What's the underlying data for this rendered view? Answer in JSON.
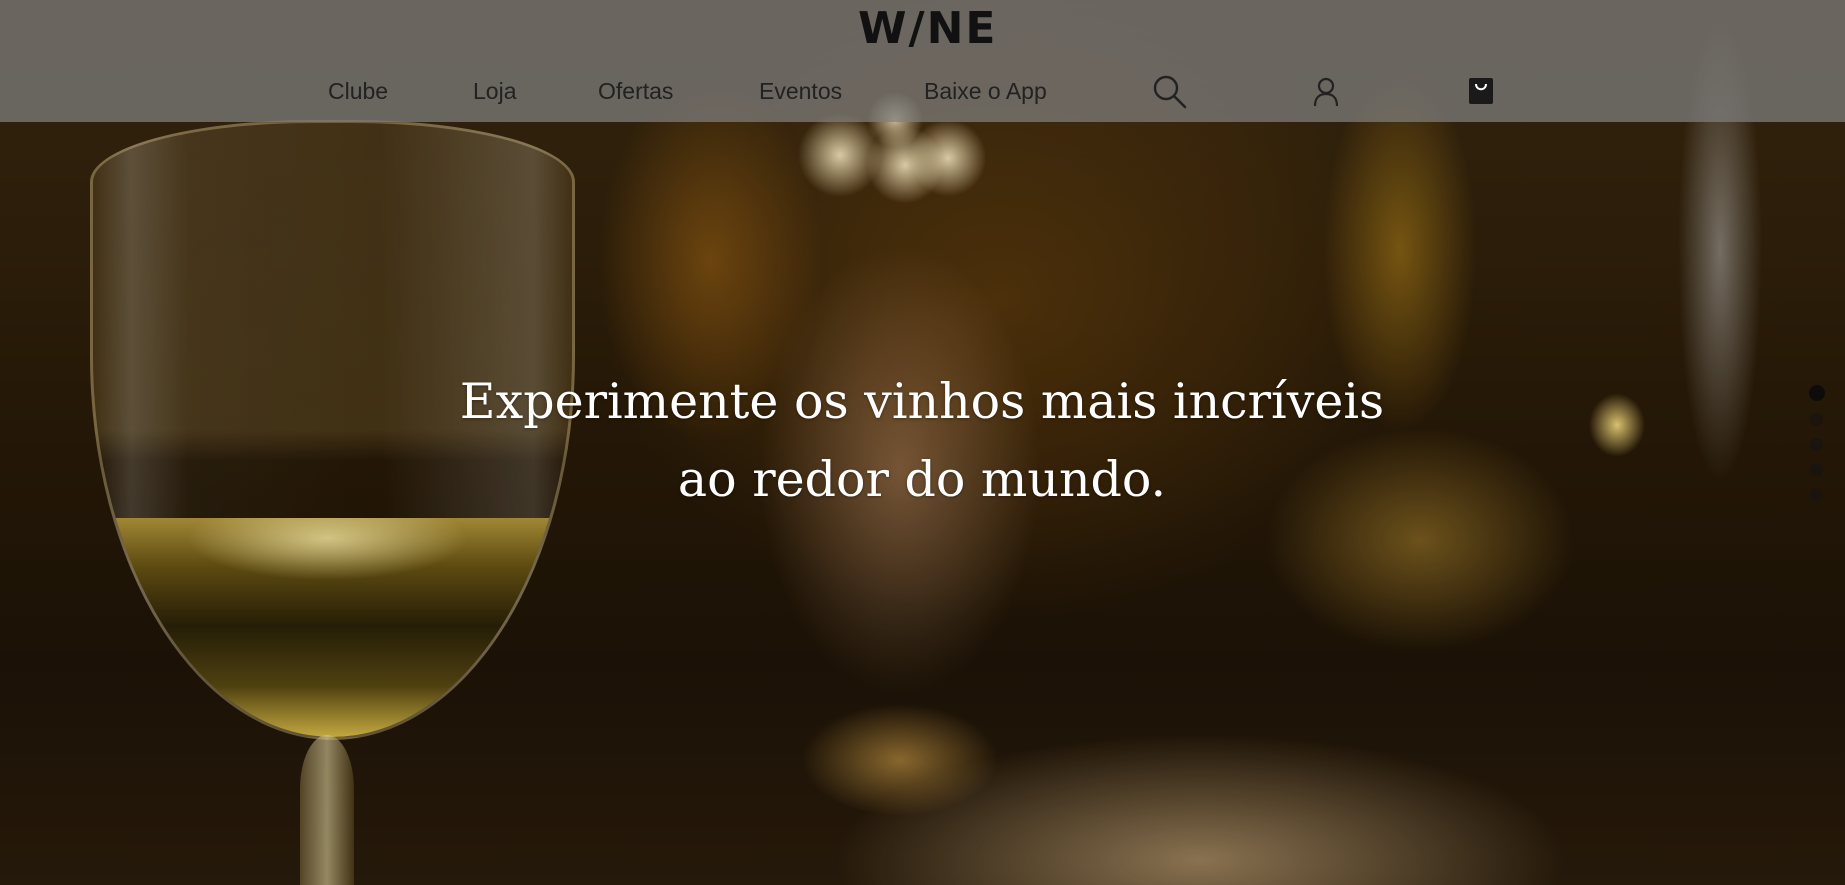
{
  "header": {
    "logo": "W/NE",
    "nav": [
      {
        "label": "Clube"
      },
      {
        "label": "Loja"
      },
      {
        "label": "Ofertas"
      },
      {
        "label": "Eventos"
      },
      {
        "label": "Baixe o App"
      }
    ],
    "icons": {
      "search": "search-icon",
      "account": "user-icon",
      "cart": "shopping-bag-icon"
    }
  },
  "hero": {
    "title_line1": "Experimente os vinhos mais incríveis",
    "title_line2": "ao redor do mundo."
  },
  "slider": {
    "total_slides": 5,
    "active_slide": 1
  },
  "colors": {
    "header_bg": "#808080",
    "text_dark": "#222222",
    "hero_text": "#ffffff"
  }
}
